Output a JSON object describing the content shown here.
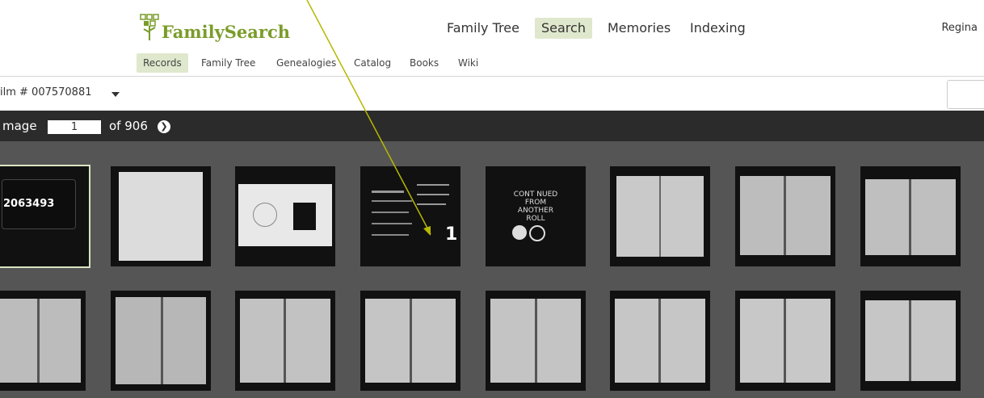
{
  "header": {
    "logo_text": "FamilySearch",
    "nav": [
      "Family Tree",
      "Search",
      "Memories",
      "Indexing"
    ],
    "active_nav": "Search",
    "user": "Regina"
  },
  "subnav": {
    "items": [
      "Records",
      "Family Tree",
      "Genealogies",
      "Catalog",
      "Books",
      "Wiki"
    ],
    "active": "Records"
  },
  "film": {
    "label": "ilm # 007570881"
  },
  "viewer": {
    "image_label": "mage",
    "image_value": "1",
    "of_label": "of 906"
  },
  "thumbnails": {
    "first_label": "2063493",
    "card_text": "CONT NUED\nFROM\nANOTHER\nROLL",
    "frame_number": "1"
  },
  "colors": {
    "accent": "#7a9c2a",
    "active_bg": "#dfe8cd",
    "viewer_bg": "#2b2b2b",
    "gallery_bg": "#555555",
    "annotation_line": "#b5b800"
  }
}
